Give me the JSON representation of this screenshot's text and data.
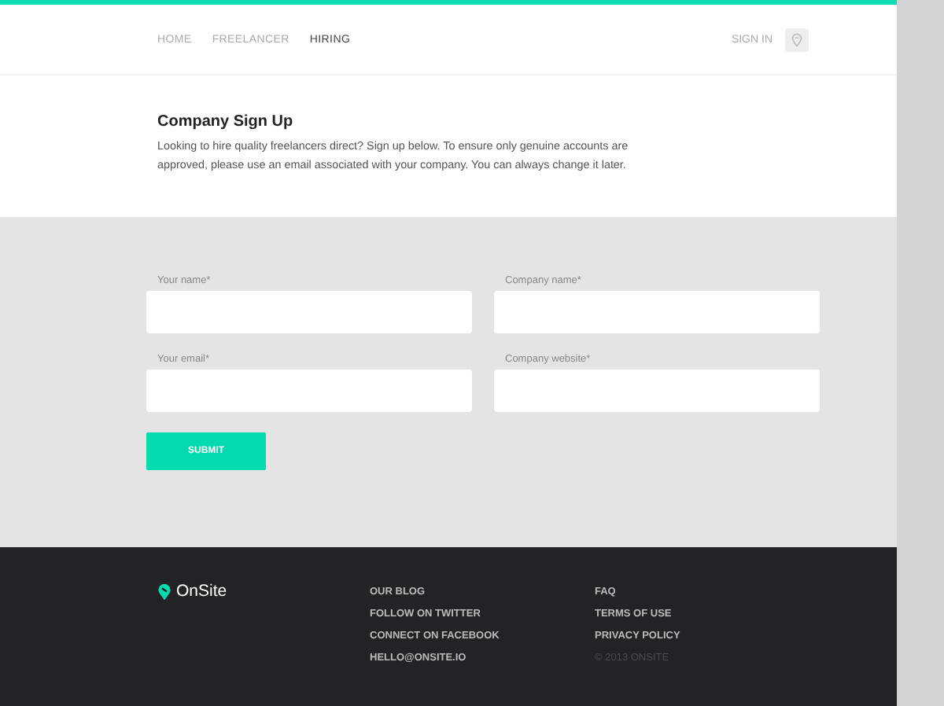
{
  "nav": {
    "items": [
      {
        "label": "HOME",
        "selected": false
      },
      {
        "label": "FREELANCER",
        "selected": false
      },
      {
        "label": "HIRING",
        "selected": true
      }
    ],
    "sign_in": "SIGN IN"
  },
  "intro": {
    "title": "Company Sign Up",
    "text": "Looking to hire quality freelancers direct? Sign up below. To ensure only genuine accounts are approved, please use an email associated with your company. You can always change it later."
  },
  "form": {
    "fields": [
      {
        "label": "Your name*"
      },
      {
        "label": "Company name*"
      },
      {
        "label": "Your email*"
      },
      {
        "label": "Company website*"
      }
    ],
    "submit": "SUBMIT"
  },
  "footer": {
    "logo": "OnSite",
    "column_1": [
      "OUR BLOG",
      "FOLLOW ON TWITTER",
      "CONNECT ON FACEBOOK",
      "HELLO@ONSITE.IO"
    ],
    "column_2": [
      "FAQ",
      "TERMS OF USE",
      "PRIVACY POLICY"
    ],
    "copyright": "© 2013 ONSITE"
  }
}
